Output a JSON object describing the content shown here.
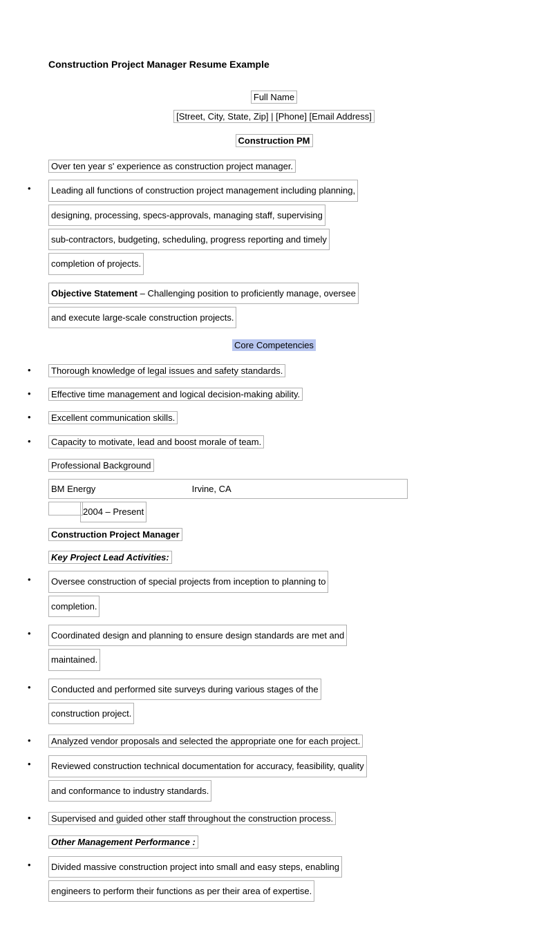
{
  "title": "Construction Project Manager Resume Example",
  "header": {
    "full_name": "Full Name",
    "address_line": "[Street, City, State, Zip] | [Phone] [Email Address]"
  },
  "role_title": "Construction PM",
  "summary": "Over ten year s' experience as construction project manager.",
  "summary_bullet": {
    "l1": "Leading all functions of construction project management including planning,",
    "l2": "designing, processing, specs-approvals, managing staff, supervising",
    "l3": "sub-contractors, budgeting, scheduling, progress reporting and timely",
    "l4": "completion of projects."
  },
  "objective": {
    "label": "Objective Statement",
    "l1": " – Challenging position to proficiently manage, oversee",
    "l2": "and execute large-scale construction projects."
  },
  "core_competencies_title": "Core Competencies",
  "competencies": [
    "Thorough knowledge of legal issues and safety standards.",
    "Effective time management and logical decision-making ability.",
    "Excellent communication skills.",
    "Capacity to motivate, lead and boost morale of team."
  ],
  "prof_background_label": "Professional Background",
  "job": {
    "company": "BM Energy",
    "location": "Irvine,  CA",
    "years": "2004 – Present",
    "position": "Construction Project Manager"
  },
  "key_activities_title": "Key Project Lead Activities:",
  "key_activities": [
    {
      "l1": "Oversee construction of special projects from inception to planning to",
      "l2": "completion."
    },
    {
      "l1": "Coordinated design and planning to ensure design standards are met and",
      "l2": "maintained."
    },
    {
      "l1": "Conducted and performed site surveys during various stages of the",
      "l2": "construction project."
    },
    {
      "l1": "Analyzed vendor proposals and selected the appropriate one for each project."
    },
    {
      "l1": "Reviewed construction technical documentation for accuracy, feasibility, quality",
      "l2": "and conformance to industry standards."
    },
    {
      "l1": "Supervised and guided other staff throughout the construction process."
    }
  ],
  "other_mgmt_title": "Other Management Performance  :",
  "other_mgmt": [
    {
      "l1": "Divided massive construction project into small and easy steps, enabling",
      "l2": "engineers to perform their functions as per their area of expertise."
    }
  ]
}
